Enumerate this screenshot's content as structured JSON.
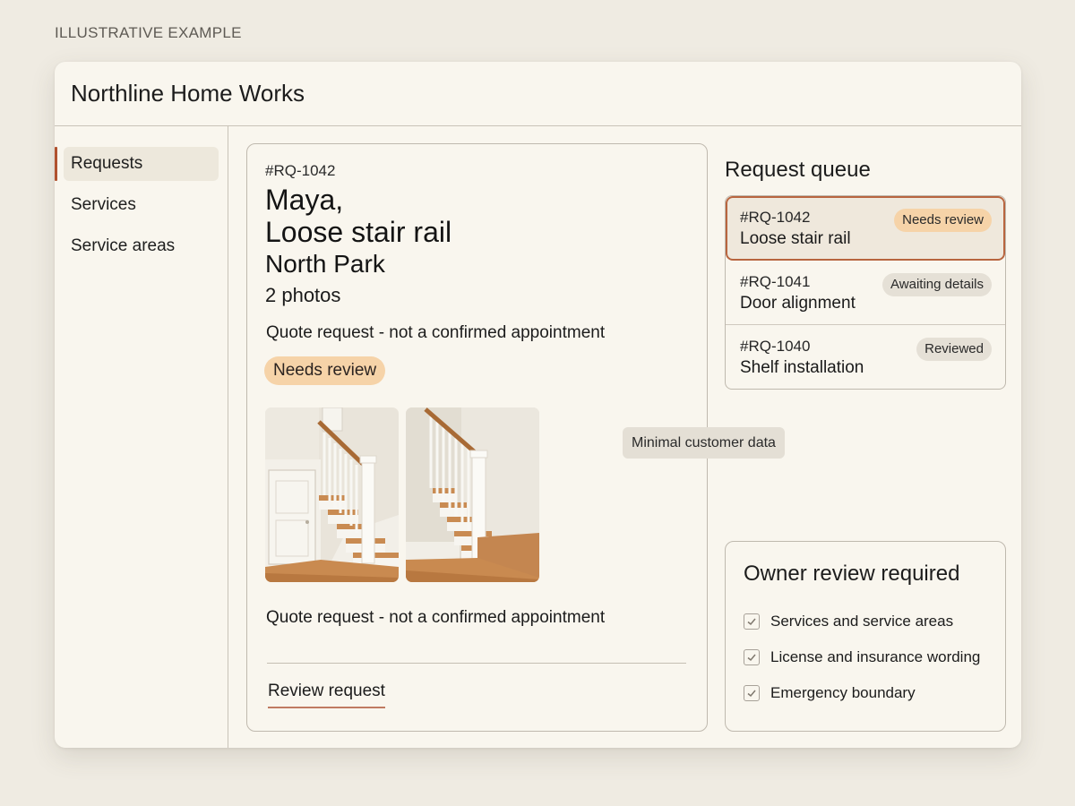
{
  "eyebrow": "ILLUSTRATIVE EXAMPLE",
  "app": {
    "title": "Northline Home Works"
  },
  "sidebar": {
    "items": [
      {
        "label": "Requests",
        "active": true
      },
      {
        "label": "Services",
        "active": false
      },
      {
        "label": "Service areas",
        "active": false
      }
    ]
  },
  "detail": {
    "id": "#RQ-1042",
    "name": "Maya,",
    "title": "Loose stair rail",
    "area": "North Park",
    "photos_label": "2 photos",
    "note_top": "Quote request - not a confirmed appointment",
    "status": "Needs review",
    "note_bottom": "Quote request - not a confirmed appointment",
    "review_link": "Review request",
    "photo_icons": [
      "staircase-photo-1",
      "staircase-photo-2"
    ]
  },
  "queue": {
    "title": "Request queue",
    "rows": [
      {
        "id": "#RQ-1042",
        "title": "Loose stair rail",
        "badge": "Needs review",
        "badge_color": "#f6d3a8",
        "selected": true
      },
      {
        "id": "#RQ-1041",
        "title": "Door alignment",
        "badge": "Awaiting details",
        "badge_color": "#e5e0d6",
        "selected": false
      },
      {
        "id": "#RQ-1040",
        "title": "Shelf installation",
        "badge": "Reviewed",
        "badge_color": "#e5e0d6",
        "selected": false
      }
    ]
  },
  "tooltip": "Minimal customer data",
  "owner_review": {
    "title": "Owner review required",
    "items": [
      {
        "label": "Services and service areas",
        "checked": true
      },
      {
        "label": "License and insurance wording",
        "checked": true
      },
      {
        "label": "Emergency boundary",
        "checked": true
      }
    ]
  },
  "colors": {
    "accent": "#b0512e",
    "needs_review": "#f6d3a8",
    "neutral_badge": "#e5e0d6",
    "background": "#efebe2",
    "surface": "#f9f6ee"
  }
}
